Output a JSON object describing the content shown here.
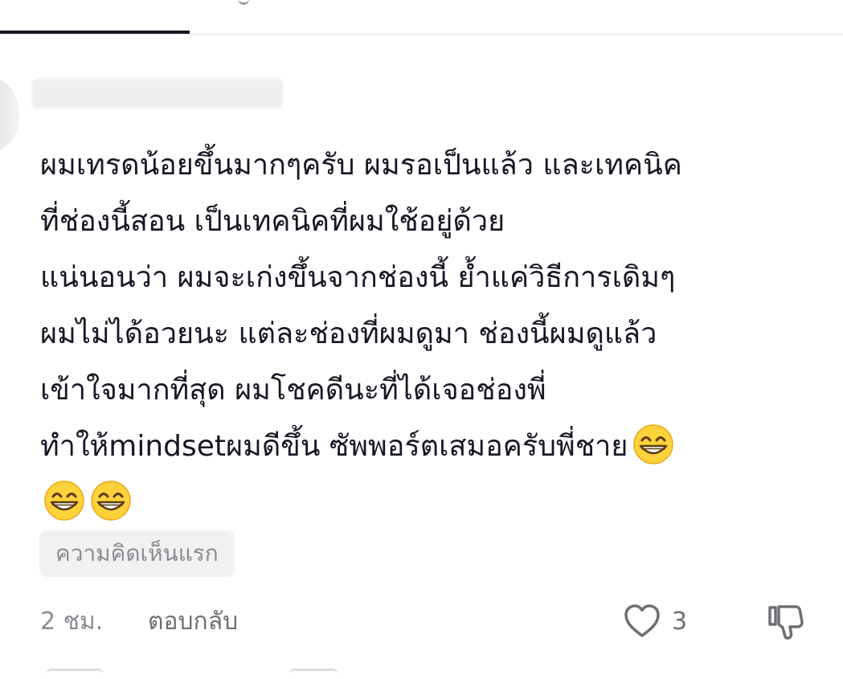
{
  "comment": {
    "lines": [
      "ผมเทรดน้อยขึ้นมากๆครับ ผมรอเป็นแล้ว และเทคนิค",
      "ที่ช่องนี้สอน เป็นเทคนิคที่ผมใช้อยู่ด้วย",
      "แน่นอนว่า ผมจะเก่งขึ้นจากช่องนี้ ย้ำแค่วิธีการเดิมๆ",
      "ผมไม่ได้อวยนะ แต่ละช่องที่ผมดูมา ช่องนี้ผมดูแล้ว",
      "เข้าใจมากที่สุด ผมโชคดีนะที่ได้เจอช่องพี่",
      "ทำให้mindsetผมดีขึ้น ซัพพอร์ตเสมอครับพี่ชาย"
    ],
    "emoji": "grinning-face-with-smiling-eyes",
    "badge": "ความคิดเห็นแรก",
    "time": "2 ชม.",
    "reply_label": "ตอบกลับ",
    "like_count": "3"
  },
  "colors": {
    "text": "#161823",
    "muted": "#8a8b91",
    "badge_bg": "#f1f1f2",
    "divider": "#e3e3e4",
    "emoji_face": "#fdd23a"
  }
}
